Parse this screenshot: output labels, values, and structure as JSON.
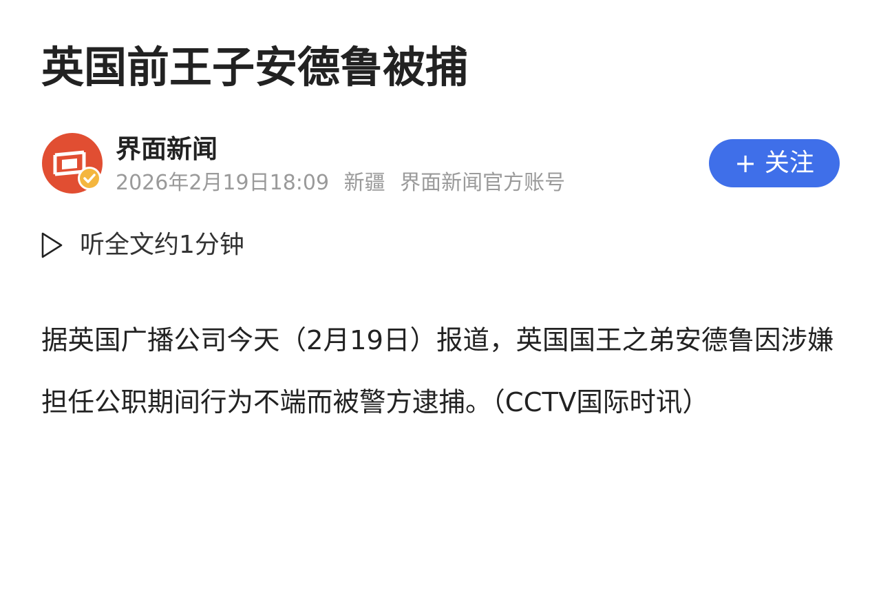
{
  "article": {
    "title": "英国前王子安德鲁被捕",
    "author": {
      "name": "界面新闻",
      "avatar_icon": "jiemian-logo-icon",
      "verified_icon": "verified-check-icon",
      "brand_color": "#e14e32",
      "verified_color": "#f4b63f"
    },
    "meta": {
      "datetime": "2026年2月19日18:09",
      "location": "新疆",
      "account_type": "界面新闻官方账号"
    },
    "follow_button": {
      "icon": "plus-icon",
      "plus": "+",
      "label": "关注",
      "color": "#3f6fe9"
    },
    "listen": {
      "icon": "play-icon",
      "label": "听全文约1分钟"
    },
    "body": "据英国广播公司今天（2月19日）报道，英国国王之弟安德鲁因涉嫌担任公职期间行为不端而被警方逮捕。（CCTV国际时讯）"
  }
}
